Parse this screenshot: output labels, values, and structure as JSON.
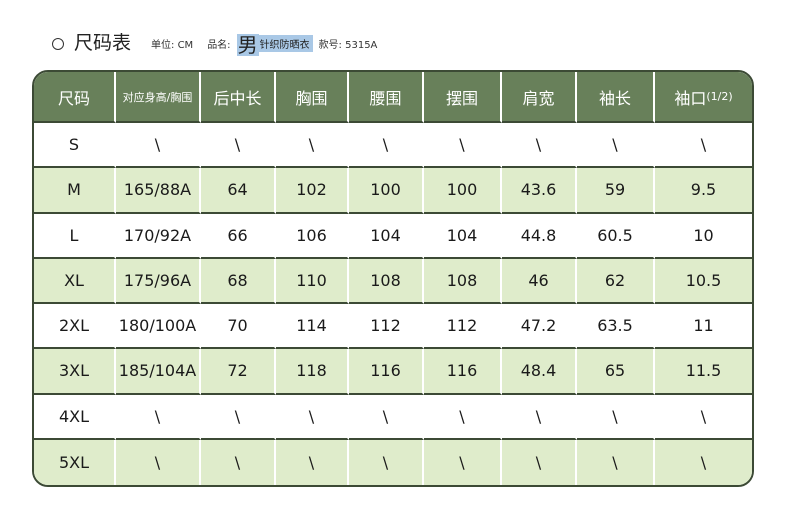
{
  "header": {
    "title": "尺码表",
    "unit_label": "单位: CM",
    "product_label": "品名:",
    "gender": "男",
    "product_name": "针织防晒衣",
    "style_label": "款号: 5315A"
  },
  "table": {
    "columns": [
      "尺码",
      "对应身高/胸围",
      "后中长",
      "胸围",
      "腰围",
      "摆围",
      "肩宽",
      "袖长",
      "袖口"
    ],
    "cuff_suffix": "(1/2)",
    "rows": [
      [
        "S",
        "\\",
        "\\",
        "\\",
        "\\",
        "\\",
        "\\",
        "\\",
        "\\"
      ],
      [
        "M",
        "165/88A",
        "64",
        "102",
        "100",
        "100",
        "43.6",
        "59",
        "9.5"
      ],
      [
        "L",
        "170/92A",
        "66",
        "106",
        "104",
        "104",
        "44.8",
        "60.5",
        "10"
      ],
      [
        "XL",
        "175/96A",
        "68",
        "110",
        "108",
        "108",
        "46",
        "62",
        "10.5"
      ],
      [
        "2XL",
        "180/100A",
        "70",
        "114",
        "112",
        "112",
        "47.2",
        "63.5",
        "11"
      ],
      [
        "3XL",
        "185/104A",
        "72",
        "118",
        "116",
        "116",
        "48.4",
        "65",
        "11.5"
      ],
      [
        "4XL",
        "\\",
        "\\",
        "\\",
        "\\",
        "\\",
        "\\",
        "\\",
        "\\"
      ],
      [
        "5XL",
        "\\",
        "\\",
        "\\",
        "\\",
        "\\",
        "\\",
        "\\",
        "\\"
      ]
    ]
  },
  "colors": {
    "header_bg": "#68805a",
    "band_green": "#dfeccb",
    "border": "#3c4a35",
    "highlight_blue": "#a9c8e6"
  }
}
